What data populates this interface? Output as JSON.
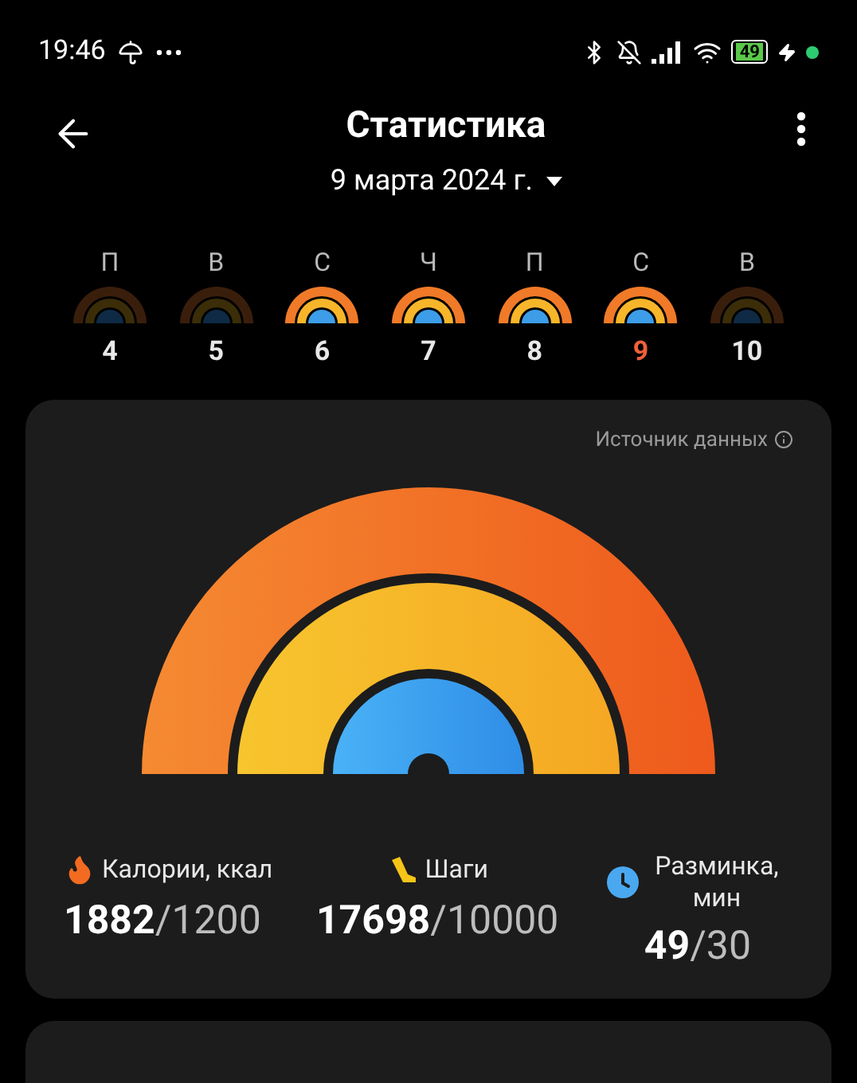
{
  "status_bar": {
    "time": "19:46",
    "battery": "49"
  },
  "header": {
    "title": "Статистика",
    "date": "9 марта 2024 г."
  },
  "days": [
    {
      "letter": "П",
      "number": "4",
      "active": false,
      "selected": false
    },
    {
      "letter": "В",
      "number": "5",
      "active": false,
      "selected": false
    },
    {
      "letter": "С",
      "number": "6",
      "active": true,
      "selected": false
    },
    {
      "letter": "Ч",
      "number": "7",
      "active": true,
      "selected": false
    },
    {
      "letter": "П",
      "number": "8",
      "active": true,
      "selected": false
    },
    {
      "letter": "С",
      "number": "9",
      "active": true,
      "selected": true
    },
    {
      "letter": "В",
      "number": "10",
      "active": false,
      "selected": false
    }
  ],
  "summary": {
    "source_link": "Источник данных",
    "metrics": [
      {
        "kind": "calories",
        "label": "Калории, ккал",
        "value": "**1882**/1200"
      },
      {
        "kind": "steps",
        "label": "Шаги",
        "value": "**17698**/10000"
      },
      {
        "kind": "warmup",
        "label": "Разминка, мин",
        "value": "**49**/30"
      }
    ]
  }
}
